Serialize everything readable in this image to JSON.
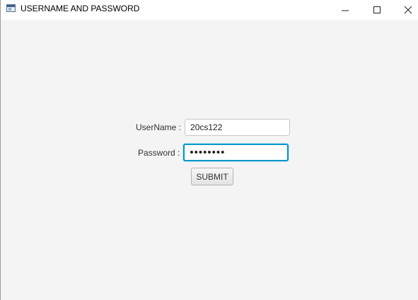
{
  "window": {
    "title": "USERNAME AND PASSWORD",
    "controls": {
      "minimize_icon": "minimize-icon",
      "maximize_icon": "maximize-icon",
      "close_icon": "close-icon"
    }
  },
  "form": {
    "username_label": "UserName :",
    "username_value": "20cs122",
    "password_label": "Password :",
    "password_value": "••••••••",
    "submit_label": "SUBMIT"
  },
  "colors": {
    "background": "#f4f4f4",
    "focus_accent": "#0096c9"
  }
}
